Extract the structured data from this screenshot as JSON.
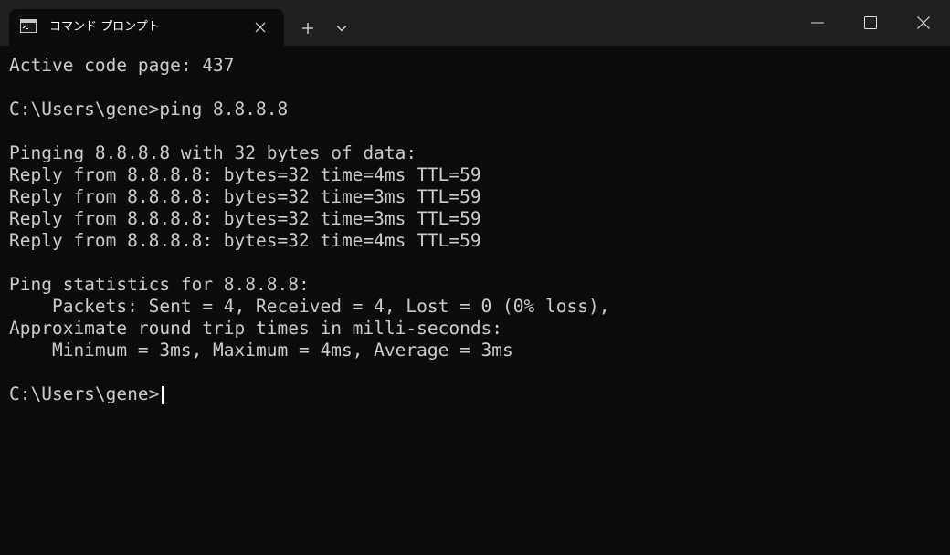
{
  "tab": {
    "title": "コマンド プロンプト",
    "icon": "cmd-icon"
  },
  "toolbar": {
    "new_tab_icon": "plus-icon",
    "dropdown_icon": "chevron-down-icon"
  },
  "window_controls": {
    "minimize_icon": "minimize-icon",
    "maximize_icon": "maximize-icon",
    "close_icon": "close-icon"
  },
  "terminal": {
    "lines": [
      "Active code page: 437",
      "",
      "C:\\Users\\gene>ping 8.8.8.8",
      "",
      "Pinging 8.8.8.8 with 32 bytes of data:",
      "Reply from 8.8.8.8: bytes=32 time=4ms TTL=59",
      "Reply from 8.8.8.8: bytes=32 time=3ms TTL=59",
      "Reply from 8.8.8.8: bytes=32 time=3ms TTL=59",
      "Reply from 8.8.8.8: bytes=32 time=4ms TTL=59",
      "",
      "Ping statistics for 8.8.8.8:",
      "    Packets: Sent = 4, Received = 4, Lost = 0 (0% loss),",
      "Approximate round trip times in milli-seconds:",
      "    Minimum = 3ms, Maximum = 4ms, Average = 3ms",
      "",
      "C:\\Users\\gene>"
    ],
    "text_color": "#cccccc",
    "background_color": "#0c0c0c"
  }
}
